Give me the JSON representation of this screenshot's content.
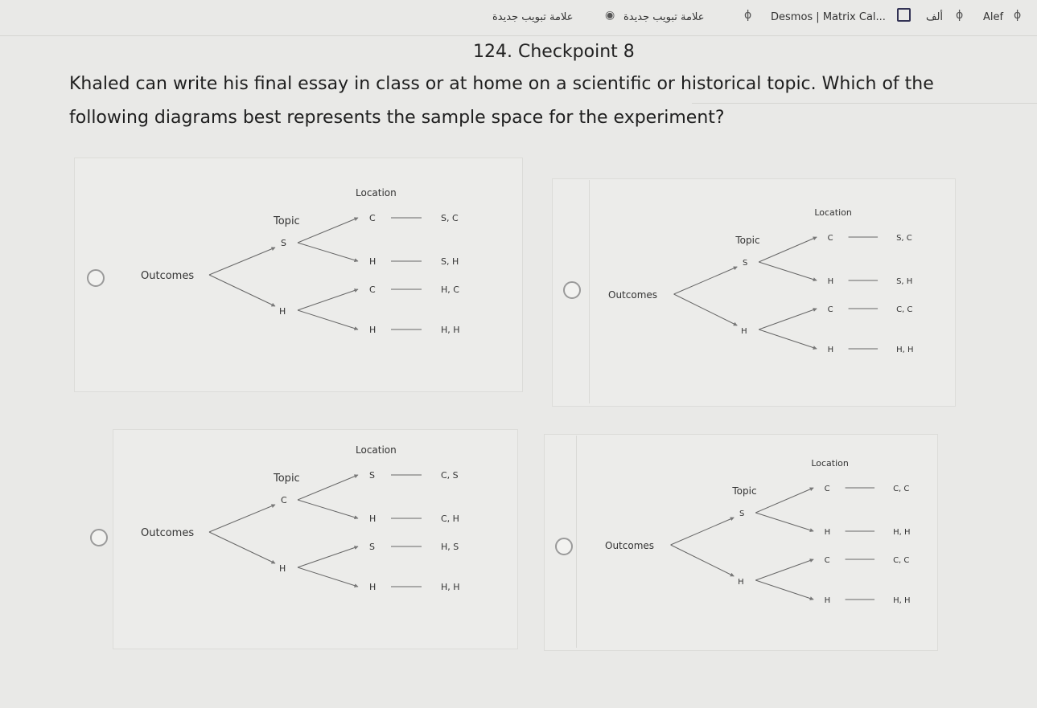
{
  "tabs": {
    "tab1": "علامة تبويب جديدة",
    "tab2": "علامة تبويب جديدة",
    "tab3": "Desmos | Matrix Cal...",
    "tab4": "ألف",
    "tab5": "Alef"
  },
  "checkpoint_title": "124. Checkpoint 8",
  "question": "Khaled can write his final essay in class or at home on a scientific or historical topic. Which of the following diagrams best represents the sample space for the experiment?",
  "options": [
    {
      "location_label": "Location",
      "topic_label": "Topic",
      "outcomes_label": "Outcomes",
      "level1": [
        "S",
        "H"
      ],
      "level2": [
        [
          "C",
          "H"
        ],
        [
          "C",
          "H"
        ]
      ],
      "results": [
        "S, C",
        "S, H",
        "H, C",
        "H, H"
      ]
    },
    {
      "location_label": "Location",
      "topic_label": "Topic",
      "outcomes_label": "Outcomes",
      "level1": [
        "S",
        "H"
      ],
      "level2": [
        [
          "C",
          "H"
        ],
        [
          "C",
          "H"
        ]
      ],
      "results": [
        "S, C",
        "S, H",
        "C, C",
        "H, H"
      ]
    },
    {
      "location_label": "Location",
      "topic_label": "Topic",
      "outcomes_label": "Outcomes",
      "level1": [
        "C",
        "H"
      ],
      "level2": [
        [
          "S",
          "H"
        ],
        [
          "S",
          "H"
        ]
      ],
      "results": [
        "C, S",
        "C, H",
        "H, S",
        "H, H"
      ]
    },
    {
      "location_label": "Location",
      "topic_label": "Topic",
      "outcomes_label": "Outcomes",
      "level1": [
        "S",
        "H"
      ],
      "level2": [
        [
          "C",
          "H"
        ],
        [
          "C",
          "H"
        ]
      ],
      "results": [
        "C, C",
        "H, H",
        "C, C",
        "H, H"
      ]
    }
  ]
}
